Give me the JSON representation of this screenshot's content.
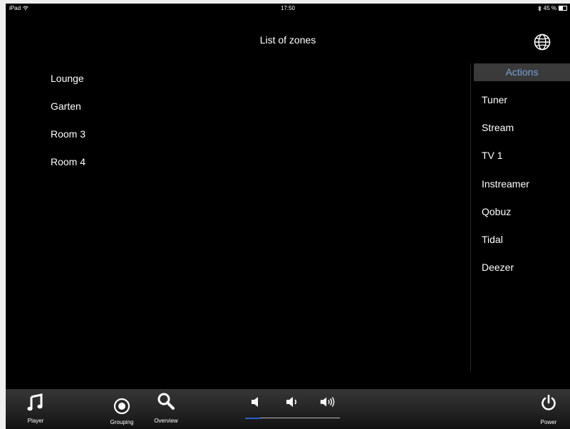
{
  "status_bar": {
    "device": "iPad",
    "time": "17:50",
    "battery": "45 %",
    "battery_level": 0.45
  },
  "header": {
    "title": "List of zones",
    "globe_icon": "globe-icon"
  },
  "zones": [
    "Lounge",
    "Garten",
    "Room 3",
    "Room 4"
  ],
  "actions": {
    "header": "Actions",
    "items": [
      "Tuner",
      "Stream",
      "TV 1",
      "Instreamer",
      "Qobuz",
      "Tidal",
      "Deezer"
    ]
  },
  "toolbar": {
    "player_label": "Player",
    "grouping_label": "Grouping",
    "overview_label": "Overview",
    "power_label": "Power",
    "volume_level": 0.16
  },
  "colors": {
    "accent": "#7aa2d6",
    "actions_header_bg": "#3a3a3a",
    "volume_fill": "#2a5cd6"
  }
}
